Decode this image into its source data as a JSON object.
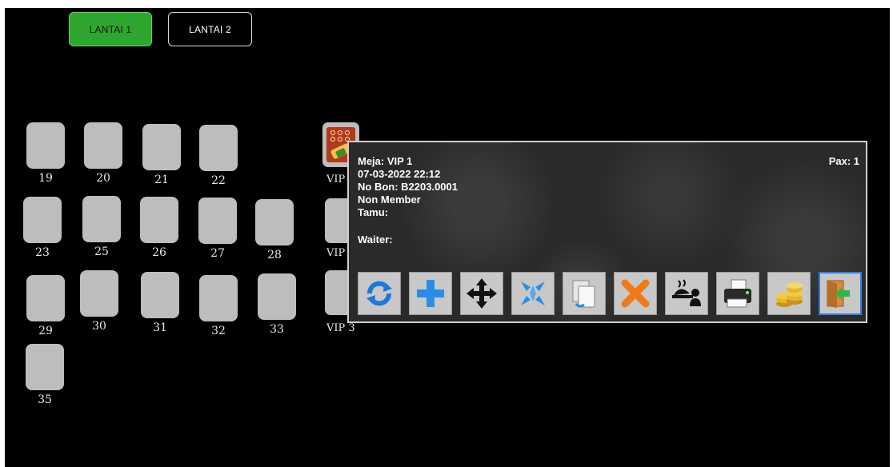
{
  "floors": [
    {
      "label": "LANTAI 1",
      "active": true
    },
    {
      "label": "LANTAI 2",
      "active": false
    }
  ],
  "tables": {
    "t19": "19",
    "t20": "20",
    "t21": "21",
    "t22": "22",
    "t23": "23",
    "t25": "25",
    "t26": "26",
    "t27": "27",
    "t28": "28",
    "t29": "29",
    "t30": "30",
    "t31": "31",
    "t32": "32",
    "t33": "33",
    "t35": "35"
  },
  "vip": {
    "vip1_partial": "VIP",
    "vip2_partial": "VIP",
    "vip3_partial": "VIP 3"
  },
  "popup": {
    "meja": "Meja: VIP 1",
    "datetime": "07-03-2022 22:12",
    "no_bon": "No Bon: B2203.0001",
    "member": "Non Member",
    "tamu": "Tamu:",
    "waiter": "Waiter:",
    "pax": "Pax: 1"
  },
  "actions": [
    {
      "icon": "refresh-icon"
    },
    {
      "icon": "add-icon"
    },
    {
      "icon": "move-icon"
    },
    {
      "icon": "merge-icon"
    },
    {
      "icon": "copy-icon"
    },
    {
      "icon": "cancel-icon"
    },
    {
      "icon": "waiter-service-icon"
    },
    {
      "icon": "printer-icon"
    },
    {
      "icon": "coins-icon"
    },
    {
      "icon": "exit-door-icon"
    }
  ],
  "colors": {
    "background": "#000000",
    "active_floor": "#2fa62f",
    "table": "#bdbdbd",
    "highlight_border": "#2f7fe0"
  }
}
